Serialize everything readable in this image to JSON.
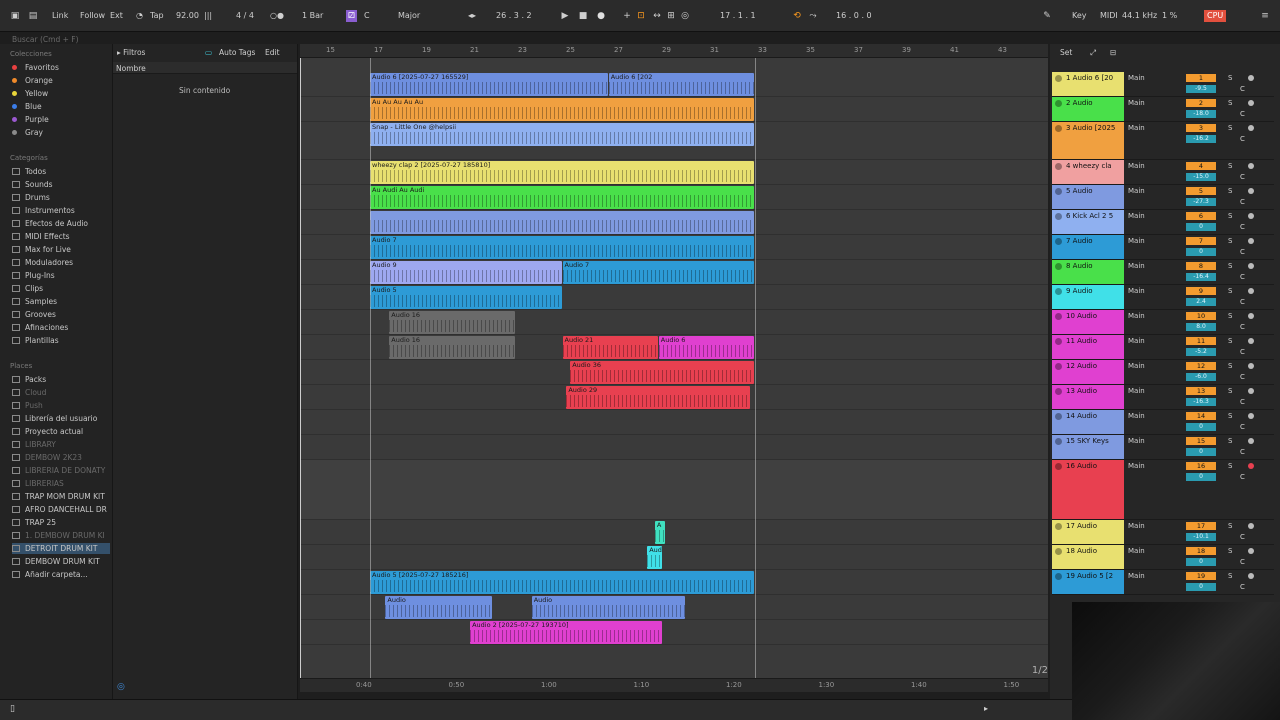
{
  "topbar": {
    "link": "Link",
    "follow": "Follow",
    "ext": "Ext",
    "tap": "Tap",
    "tempo": "92.00",
    "signature": "4 / 4",
    "quantize": "1 Bar",
    "key_root": "C",
    "scale": "Major",
    "position": "26 .  3 .  2",
    "loop_start": "17 .  1 .  1",
    "loop_length": "16 .  0 .  0",
    "key": "Key",
    "midi": "MIDI",
    "sample_rate": "44.1 kHz",
    "cpu": "1 %"
  },
  "sidebar": {
    "search_placeholder": "Buscar (Cmd + F)",
    "collections_header": "Colecciones",
    "collections": [
      {
        "label": "Favoritos",
        "color": "#e84040"
      },
      {
        "label": "Orange",
        "color": "#f08a2a"
      },
      {
        "label": "Yellow",
        "color": "#e8d53a"
      },
      {
        "label": "Blue",
        "color": "#3b7de8"
      },
      {
        "label": "Purple",
        "color": "#9b59d0"
      },
      {
        "label": "Gray",
        "color": "#8a8a8a"
      }
    ],
    "categories_header": "Categorías",
    "categories": [
      "Todos",
      "Sounds",
      "Drums",
      "Instrumentos",
      "Efectos de Audio",
      "MIDI Effects",
      "Max for Live",
      "Moduladores",
      "Plug-Ins",
      "Clips",
      "Samples",
      "Grooves",
      "Afinaciones",
      "Plantillas"
    ],
    "places_header": "Places",
    "places": [
      "Packs",
      "Cloud",
      "Push",
      "Librería del usuario",
      "Proyecto actual",
      "LIBRARY",
      "DEMBOW 2K23",
      "LIBRERIA DE DONATY",
      "LIBRERIAS",
      "TRAP MOM DRUM KIT",
      "AFRO DANCEHALL DR",
      "TRAP 25",
      "1. DEMBOW DRUM KI",
      "DETROIT DRUM KIT",
      "DEMBOW DRUM KIT",
      "Añadir carpeta..."
    ],
    "places_dim": [
      false,
      true,
      true,
      false,
      false,
      true,
      true,
      true,
      true,
      false,
      false,
      false,
      true,
      false,
      false,
      false
    ]
  },
  "browser": {
    "filters": "Filtros",
    "auto_tags": "Auto Tags",
    "edit": "Edit",
    "column": "Nombre",
    "empty": "Sin contenido"
  },
  "ruler": {
    "bars": [
      "15",
      "17",
      "19",
      "21",
      "23",
      "25",
      "27",
      "29",
      "31",
      "33",
      "35",
      "37",
      "39",
      "41",
      "43"
    ]
  },
  "timeline": {
    "times": [
      "0:40",
      "0:50",
      "1:00",
      "1:10",
      "1:20",
      "1:30",
      "1:40",
      "1:50"
    ],
    "page": "1/2"
  },
  "clips": [
    {
      "lane": 0,
      "start": 0,
      "len": 0.62,
      "name": "Audio 6 [2025-07-27 165529]",
      "color": "#6e8fe0"
    },
    {
      "lane": 0,
      "start": 0.62,
      "len": 0.38,
      "name": "Audio 6 [202",
      "color": "#6e8fe0"
    },
    {
      "lane": 1,
      "start": 0,
      "len": 1,
      "name": "Au Au Au Au Au",
      "color": "#f0a040"
    },
    {
      "lane": 2,
      "start": 0,
      "len": 1,
      "name": "Snap - Little One @helpsii",
      "color": "#8fb0f0"
    },
    {
      "lane": 3,
      "start": 0,
      "len": 1,
      "name": "wheezy clap 2 [2025-07-27 185810]",
      "color": "#e8e070"
    },
    {
      "lane": 4,
      "start": 0,
      "len": 1,
      "name": "Au Audi Au Audi",
      "color": "#49e04a"
    },
    {
      "lane": 5,
      "start": 0,
      "len": 1,
      "name": "",
      "color": "#7f9ae0"
    },
    {
      "lane": 6,
      "start": 0,
      "len": 1,
      "name": "Audio 7",
      "color": "#2d9bd6"
    },
    {
      "lane": 7,
      "start": 0,
      "len": 0.5,
      "name": "Audio 9",
      "color": "#9ea8f0"
    },
    {
      "lane": 7,
      "start": 0.5,
      "len": 0.5,
      "name": "Audio 7",
      "color": "#2d9bd6"
    },
    {
      "lane": 8,
      "start": 0,
      "len": 0.5,
      "name": "Audio 5",
      "color": "#2d9bd6"
    },
    {
      "lane": 9,
      "start": 0.05,
      "len": 0.33,
      "name": "Audio 16",
      "color": "#6a6a6a"
    },
    {
      "lane": 10,
      "start": 0.05,
      "len": 0.33,
      "name": "Audio 16",
      "color": "#6a6a6a"
    },
    {
      "lane": 10,
      "start": 0.5,
      "len": 0.25,
      "name": "Audio 21",
      "color": "#e84050"
    },
    {
      "lane": 10,
      "start": 0.75,
      "len": 0.25,
      "name": "Audio 6",
      "color": "#e040d0"
    },
    {
      "lane": 11,
      "start": 0.52,
      "len": 0.48,
      "name": "Audio 36",
      "color": "#e84050"
    },
    {
      "lane": 12,
      "start": 0.51,
      "len": 0.48,
      "name": "Audio 29",
      "color": "#e84050"
    },
    {
      "lane": 16,
      "start": 0.74,
      "len": 0.03,
      "name": "A",
      "color": "#40e0c0"
    },
    {
      "lane": 17,
      "start": 0.72,
      "len": 0.04,
      "name": "Aud",
      "color": "#40e0e8"
    },
    {
      "lane": 18,
      "start": 0,
      "len": 1,
      "name": "Audio 5 [2025-07-27 185216]",
      "color": "#2d9bd6"
    },
    {
      "lane": 19,
      "start": 0.04,
      "len": 0.28,
      "name": "Audio",
      "color": "#6e8fe0"
    },
    {
      "lane": 19,
      "start": 0.42,
      "len": 0.4,
      "name": "Audio",
      "color": "#6e8fe0"
    },
    {
      "lane": 20,
      "start": 0.26,
      "len": 0.5,
      "name": "Audio 2 [2025-07-27 193710]",
      "color": "#e040d0"
    }
  ],
  "tracks": [
    {
      "name": "1 Audio 6 [20",
      "color": "#e8e070",
      "num": "1",
      "vol": "-9.5",
      "h": 25
    },
    {
      "name": "2 Audio",
      "color": "#49e04a",
      "num": "2",
      "vol": "-18.0",
      "h": 25
    },
    {
      "name": "3 Audio [2025",
      "color": "#f0a040",
      "num": "3",
      "vol": "-16.2",
      "h": 38
    },
    {
      "name": "4 wheezy cla",
      "color": "#f0a0a0",
      "num": "4",
      "vol": "-15.0",
      "h": 25
    },
    {
      "name": "5 Audio",
      "color": "#7f9ae0",
      "num": "5",
      "vol": "-27.3",
      "h": 25
    },
    {
      "name": "6 Kick Acl 2 5",
      "color": "#8fb0f0",
      "num": "6",
      "vol": "0",
      "h": 25
    },
    {
      "name": "7 Audio",
      "color": "#2d9bd6",
      "num": "7",
      "vol": "0",
      "h": 25
    },
    {
      "name": "8 Audio",
      "color": "#49e04a",
      "num": "8",
      "vol": "-16.4",
      "h": 25
    },
    {
      "name": "9 Audio",
      "color": "#40e0e8",
      "num": "9",
      "vol": "2.4",
      "h": 25
    },
    {
      "name": "10 Audio",
      "color": "#e040d0",
      "num": "10",
      "vol": "8.0",
      "h": 25
    },
    {
      "name": "11 Audio",
      "color": "#e040d0",
      "num": "11",
      "vol": "-5.2",
      "h": 25
    },
    {
      "name": "12 Audio",
      "color": "#e040d0",
      "num": "12",
      "vol": "-6.0",
      "h": 25
    },
    {
      "name": "13 Audio",
      "color": "#e040d0",
      "num": "13",
      "vol": "-16.3",
      "h": 25
    },
    {
      "name": "14 Audio",
      "color": "#7f9ae0",
      "num": "14",
      "vol": "0",
      "h": 25
    },
    {
      "name": "15 SKY Keys",
      "color": "#7f9ae0",
      "num": "15",
      "vol": "0",
      "h": 25
    },
    {
      "name": "16 Audio",
      "color": "#e84050",
      "num": "16",
      "vol": "0",
      "h": 60
    },
    {
      "name": "17 Audio",
      "color": "#e8e070",
      "num": "17",
      "vol": "-10.1",
      "h": 25
    },
    {
      "name": "18 Audio",
      "color": "#e8e070",
      "num": "18",
      "vol": "0",
      "h": 25
    },
    {
      "name": "19 Audio 5 [2",
      "color": "#2d9bd6",
      "num": "19",
      "vol": "0",
      "h": 25
    }
  ],
  "track_io": "Main",
  "track_solo": "S",
  "track_c": "C"
}
